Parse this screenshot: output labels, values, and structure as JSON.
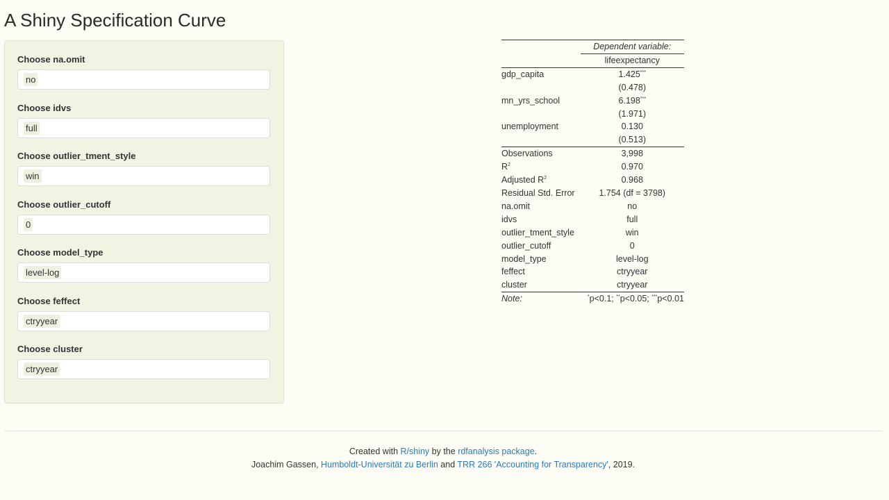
{
  "title": "A Shiny Specification Curve",
  "inputs": [
    {
      "label": "Choose na.omit",
      "value": "no"
    },
    {
      "label": "Choose idvs",
      "value": "full"
    },
    {
      "label": "Choose outlier_tment_style",
      "value": "win"
    },
    {
      "label": "Choose outlier_cutoff",
      "value": "0"
    },
    {
      "label": "Choose model_type",
      "value": "level-log"
    },
    {
      "label": "Choose feffect",
      "value": "ctryyear"
    },
    {
      "label": "Choose cluster",
      "value": "ctryyear"
    }
  ],
  "table": {
    "dep_header": "Dependent variable:",
    "dep_var": "lifeexpectancy",
    "coefs": [
      {
        "name": "gdp_capita",
        "est": "1.425",
        "stars": "***",
        "se": "(0.478)"
      },
      {
        "name": "mn_yrs_school",
        "est": "6.198",
        "stars": "***",
        "se": "(1.971)"
      },
      {
        "name": "unemployment",
        "est": "0.130",
        "stars": "",
        "se": "(0.513)"
      }
    ],
    "stats": [
      {
        "name": "Observations",
        "value": "3,998"
      },
      {
        "name": "R",
        "sup": "2",
        "value": "0.970"
      },
      {
        "name": "Adjusted R",
        "sup": "2",
        "value": "0.968"
      },
      {
        "name": "Residual Std. Error",
        "value": "1.754 (df = 3798)"
      },
      {
        "name": "na.omit",
        "value": "no"
      },
      {
        "name": "idvs",
        "value": "full"
      },
      {
        "name": "outlier_tment_style",
        "value": "win"
      },
      {
        "name": "outlier_cutoff",
        "value": "0"
      },
      {
        "name": "model_type",
        "value": "level-log"
      },
      {
        "name": "feffect",
        "value": "ctryyear"
      },
      {
        "name": "cluster",
        "value": "ctryyear"
      }
    ],
    "note_label": "Note:",
    "note": {
      "s1": "*",
      "t1": "p<0.1; ",
      "s2": "**",
      "t2": "p<0.05; ",
      "s3": "***",
      "t3": "p<0.01"
    }
  },
  "footer": {
    "l1a": "Created with ",
    "l1link1": "R/shiny",
    "l1b": " by the ",
    "l1link2": "rdfanalysis package",
    "l1c": ".",
    "l2a": "Joachim Gassen, ",
    "l2link1": "Humboldt-Universität zu Berlin",
    "l2b": " and ",
    "l2link2": "TRR 266 'Accounting for Transparency'",
    "l2c": ", 2019."
  }
}
